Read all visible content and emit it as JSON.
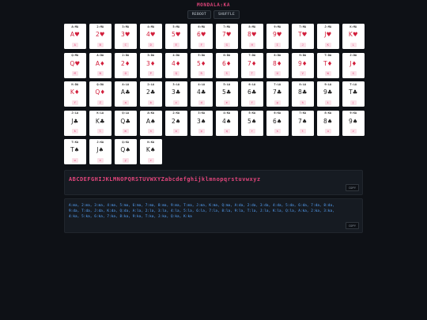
{
  "title": "MONDALA:KA",
  "buttons": {
    "reboot": "REBOOT",
    "shuffle": "SHUFFLE"
  },
  "cards": [
    {
      "code": "A:MA",
      "rank": "A",
      "suit": "♥",
      "color": "red",
      "key": "A"
    },
    {
      "code": "2:MA",
      "rank": "2",
      "suit": "♥",
      "color": "red",
      "key": "B"
    },
    {
      "code": "3:MA",
      "rank": "3",
      "suit": "♥",
      "color": "red",
      "key": "C"
    },
    {
      "code": "4:MA",
      "rank": "4",
      "suit": "♥",
      "color": "red",
      "key": "D"
    },
    {
      "code": "5:MA",
      "rank": "5",
      "suit": "♥",
      "color": "red",
      "key": "E"
    },
    {
      "code": "6:MA",
      "rank": "6",
      "suit": "♥",
      "color": "red",
      "key": "F"
    },
    {
      "code": "7:MA",
      "rank": "7",
      "suit": "♥",
      "color": "red",
      "key": "G"
    },
    {
      "code": "8:MA",
      "rank": "8",
      "suit": "♥",
      "color": "red",
      "key": "H"
    },
    {
      "code": "9:MA",
      "rank": "9",
      "suit": "♥",
      "color": "red",
      "key": "I"
    },
    {
      "code": "T:MA",
      "rank": "T",
      "suit": "♥",
      "color": "red",
      "key": "J"
    },
    {
      "code": "J:MA",
      "rank": "J",
      "suit": "♥",
      "color": "red",
      "key": "K"
    },
    {
      "code": "K:MA",
      "rank": "K",
      "suit": "♥",
      "color": "red",
      "key": "L"
    },
    {
      "code": "Q:MA",
      "rank": "Q",
      "suit": "♥",
      "color": "red",
      "key": "M"
    },
    {
      "code": "A:DA",
      "rank": "A",
      "suit": "♦",
      "color": "red",
      "key": "N"
    },
    {
      "code": "2:DA",
      "rank": "2",
      "suit": "♦",
      "color": "red",
      "key": "O"
    },
    {
      "code": "3:DA",
      "rank": "3",
      "suit": "♦",
      "color": "red",
      "key": "P"
    },
    {
      "code": "4:DA",
      "rank": "4",
      "suit": "♦",
      "color": "red",
      "key": "Q"
    },
    {
      "code": "5:DA",
      "rank": "5",
      "suit": "♦",
      "color": "red",
      "key": "R"
    },
    {
      "code": "6:DA",
      "rank": "6",
      "suit": "♦",
      "color": "red",
      "key": "S"
    },
    {
      "code": "7:DA",
      "rank": "7",
      "suit": "♦",
      "color": "red",
      "key": "T"
    },
    {
      "code": "8:DA",
      "rank": "8",
      "suit": "♦",
      "color": "red",
      "key": "U"
    },
    {
      "code": "9:DA",
      "rank": "9",
      "suit": "♦",
      "color": "red",
      "key": "V"
    },
    {
      "code": "T:DA",
      "rank": "T",
      "suit": "♦",
      "color": "red",
      "key": "W"
    },
    {
      "code": "J:DA",
      "rank": "J",
      "suit": "♦",
      "color": "red",
      "key": "X"
    },
    {
      "code": "K:DA",
      "rank": "K",
      "suit": "♦",
      "color": "red",
      "key": "Y"
    },
    {
      "code": "Q:DA",
      "rank": "Q",
      "suit": "♦",
      "color": "red",
      "key": "Z"
    },
    {
      "code": "A:LA",
      "rank": "A",
      "suit": "♣",
      "color": "black",
      "key": "a"
    },
    {
      "code": "2:LA",
      "rank": "2",
      "suit": "♣",
      "color": "black",
      "key": "b"
    },
    {
      "code": "3:LA",
      "rank": "3",
      "suit": "♣",
      "color": "black",
      "key": "c"
    },
    {
      "code": "4:LA",
      "rank": "4",
      "suit": "♣",
      "color": "black",
      "key": "d"
    },
    {
      "code": "5:LA",
      "rank": "5",
      "suit": "♣",
      "color": "black",
      "key": "e"
    },
    {
      "code": "6:LA",
      "rank": "6",
      "suit": "♣",
      "color": "black",
      "key": "f"
    },
    {
      "code": "7:LA",
      "rank": "7",
      "suit": "♣",
      "color": "black",
      "key": "g"
    },
    {
      "code": "8:LA",
      "rank": "8",
      "suit": "♣",
      "color": "black",
      "key": "h"
    },
    {
      "code": "9:LA",
      "rank": "9",
      "suit": "♣",
      "color": "black",
      "key": "i"
    },
    {
      "code": "T:LA",
      "rank": "T",
      "suit": "♣",
      "color": "black",
      "key": "j"
    },
    {
      "code": "J:LA",
      "rank": "J",
      "suit": "♣",
      "color": "black",
      "key": "k"
    },
    {
      "code": "K:LA",
      "rank": "K",
      "suit": "♣",
      "color": "black",
      "key": "l"
    },
    {
      "code": "Q:LA",
      "rank": "Q",
      "suit": "♣",
      "color": "black",
      "key": "m"
    },
    {
      "code": "A:KA",
      "rank": "A",
      "suit": "♠",
      "color": "black",
      "key": "n"
    },
    {
      "code": "2:KA",
      "rank": "2",
      "suit": "♠",
      "color": "black",
      "key": "o"
    },
    {
      "code": "3:KA",
      "rank": "3",
      "suit": "♠",
      "color": "black",
      "key": "p"
    },
    {
      "code": "4:KA",
      "rank": "4",
      "suit": "♠",
      "color": "black",
      "key": "q"
    },
    {
      "code": "5:KA",
      "rank": "5",
      "suit": "♠",
      "color": "black",
      "key": "r"
    },
    {
      "code": "6:KA",
      "rank": "6",
      "suit": "♠",
      "color": "black",
      "key": "s"
    },
    {
      "code": "7:KA",
      "rank": "7",
      "suit": "♠",
      "color": "black",
      "key": "t"
    },
    {
      "code": "8:KA",
      "rank": "8",
      "suit": "♠",
      "color": "black",
      "key": "u"
    },
    {
      "code": "9:KA",
      "rank": "9",
      "suit": "♠",
      "color": "black",
      "key": "v"
    },
    {
      "code": "T:KA",
      "rank": "T",
      "suit": "♠",
      "color": "black",
      "key": "w"
    },
    {
      "code": "J:KA",
      "rank": "J",
      "suit": "♠",
      "color": "black",
      "key": "x"
    },
    {
      "code": "Q:KA",
      "rank": "Q",
      "suit": "♠",
      "color": "black",
      "key": "y"
    },
    {
      "code": "K:KA",
      "rank": "K",
      "suit": "♠",
      "color": "black",
      "key": "z"
    }
  ],
  "sequence": {
    "text": "ABCDEFGHIJKLMNOPQRSTUVWXYZabcdefghijklmnopqrstuvwxyz",
    "copy_label": "COPY"
  },
  "mapping": {
    "text": "A:ma, 2:ma, 3:ma, 4:ma, 5:ma, 6:ma, 7:ma, 8:ma, 9:ma, T:ma, J:ma, K:ma, Q:ma, A:da, 2:da, 3:da, 4:da, 5:da, 6:da, 7:da, 8:da, 9:da, T:da, J:da, K:da, Q:da, A:la, 2:la, 3:la, 4:la, 5:la, 6:la, 7:la, 8:la, 9:la, T:la, J:la, K:la, Q:la, A:ka, 2:ka, 3:ka, 4:ka, 5:ka, 6:ka, 7:ka, 8:ka, 9:ka, T:ka, J:ka, Q:ka, K:ka",
    "copy_label": "COPY"
  },
  "colors": {
    "background": "#0e1116",
    "accent": "#e0457b",
    "link": "#58a6ff",
    "card_red": "#d21f3c",
    "card_black": "#222222"
  }
}
